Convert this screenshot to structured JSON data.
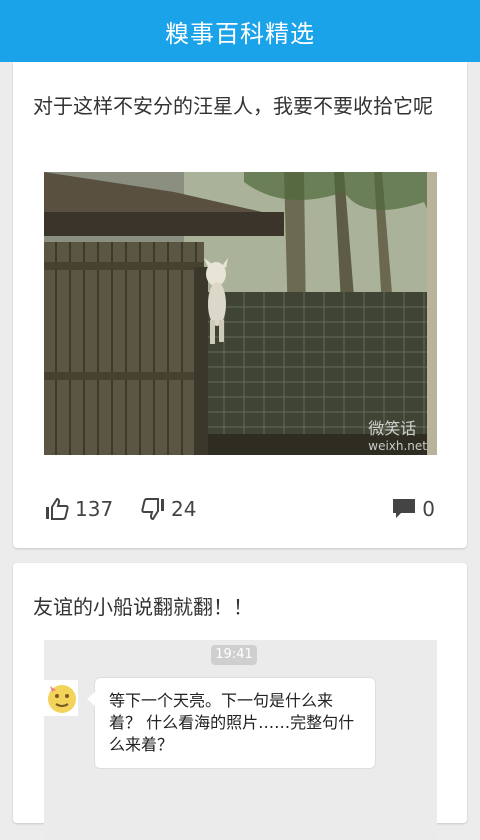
{
  "app": {
    "title": "糗事百科精选",
    "accent": "#1aa3e8"
  },
  "posts": [
    {
      "text": "对于这样不安分的汪星人，我要不要收拾它呢",
      "image": {
        "watermark": "微笑话",
        "watermark_url": "weixh.net"
      },
      "likes": "137",
      "dislikes": "24",
      "comments": "0"
    },
    {
      "text": "友谊的小船说翻就翻！！",
      "chat": {
        "time": "19:41",
        "message": "等下一个天亮。下一句是什么来着？ 什么看海的照片……完整句什么来着？"
      }
    }
  ],
  "icons": {
    "like": "thumbs-up-icon",
    "dislike": "thumbs-down-icon",
    "comment": "comment-bubble-icon"
  }
}
